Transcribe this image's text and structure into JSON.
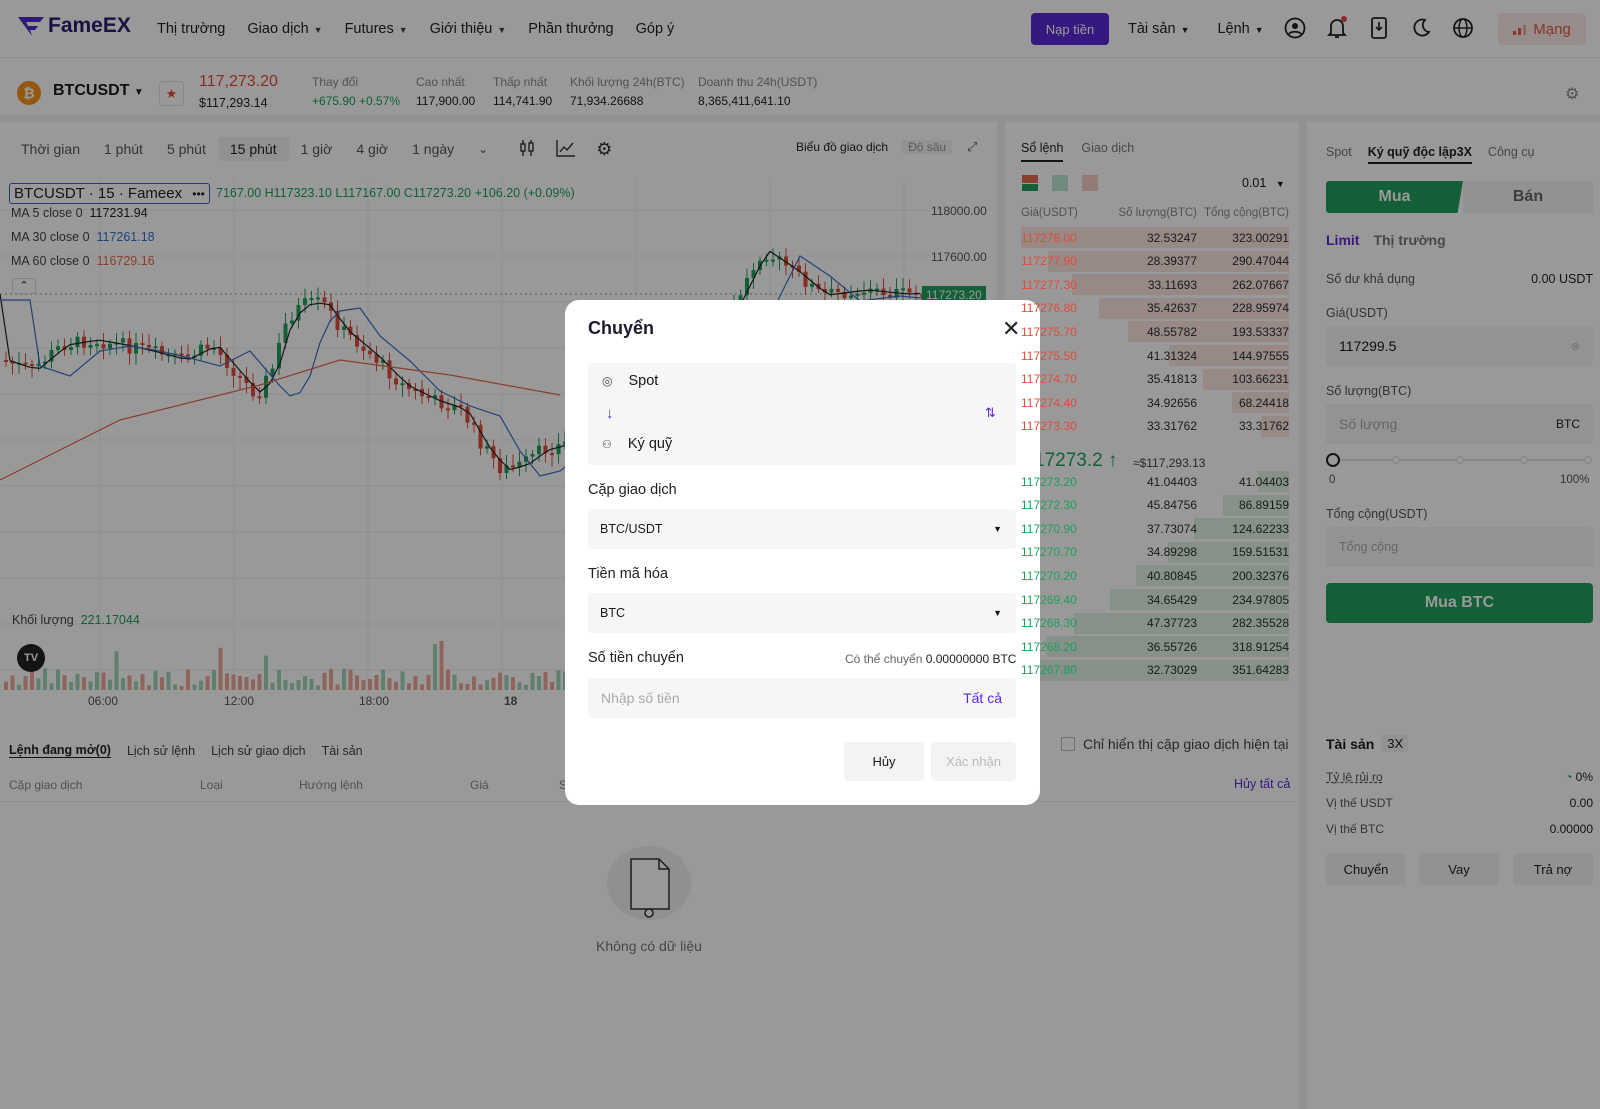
{
  "brand": {
    "name": "FameEX"
  },
  "nav": {
    "links": [
      "Thị trường",
      "Giao dịch",
      "Futures",
      "Giới thiệu",
      "Phần thưởng",
      "Góp ý"
    ],
    "deposit": "Nạp tiền",
    "assets": "Tài sản",
    "orders": "Lệnh",
    "network": "Mạng",
    "icons": [
      "user-icon",
      "bell-icon",
      "download-app-icon",
      "moon-icon",
      "globe-icon"
    ]
  },
  "ticker": {
    "pair": "BTCUSDT",
    "last": "117,273.20",
    "usd": "$117,293.14",
    "stats": [
      {
        "label": "Thay đổi",
        "value": "+675.90 +0.57%"
      },
      {
        "label": "Cao nhất",
        "value": "117,900.00"
      },
      {
        "label": "Thấp nhất",
        "value": "114,741.90"
      },
      {
        "label": "Khối lượng 24h(BTC)",
        "value": "71,934.26688"
      },
      {
        "label": "Doanh thu 24h(USDT)",
        "value": "8,365,411,641.10"
      }
    ]
  },
  "chart": {
    "timeframes": [
      "Thời gian",
      "1 phút",
      "5 phút",
      "15 phút",
      "1 giờ",
      "4 giờ",
      "1 ngày"
    ],
    "selected": "15 phút",
    "mode_trade": "Biểu đồ giao dịch",
    "mode_depth": "Độ sâu",
    "symbol_legend": "BTCUSDT · 15 · Fameex",
    "ohlc": "7167.00  H117323.10  L117167.00  C117273.20  +106.20 (+0.09%)",
    "ma": [
      {
        "label": "MA 5 close 0",
        "value": "117231.94",
        "color": "#222222"
      },
      {
        "label": "MA 30 close 0",
        "value": "117261.18",
        "color": "#3b6fc7"
      },
      {
        "label": "MA 60 close 0",
        "value": "116729.16",
        "color": "#e36a4b"
      }
    ],
    "volume_label": "Khối lượng",
    "volume_value": "221.17044",
    "y_ticks": [
      "118000.00",
      "117600.00"
    ],
    "current_price_tag": "117273.20",
    "x_ticks": [
      "06:00",
      "12:00",
      "18:00",
      "18"
    ]
  },
  "orderbook": {
    "tabs": [
      "Sổ lệnh",
      "Giao dịch"
    ],
    "precision": "0.01",
    "headers": [
      "Giá(USDT)",
      "Số lượng(BTC)",
      "Tổng cộng(BTC)"
    ],
    "asks": [
      [
        "117278.00",
        "32.53247",
        "323.00291"
      ],
      [
        "117277.90",
        "28.39377",
        "290.47044"
      ],
      [
        "117277.30",
        "33.11693",
        "262.07667"
      ],
      [
        "117276.80",
        "35.42637",
        "228.95974"
      ],
      [
        "117275.70",
        "48.55782",
        "193.53337"
      ],
      [
        "117275.50",
        "41.31324",
        "144.97555"
      ],
      [
        "117274.70",
        "35.41813",
        "103.66231"
      ],
      [
        "117274.40",
        "34.92656",
        "68.24418"
      ],
      [
        "117273.30",
        "33.31762",
        "33.31762"
      ]
    ],
    "mid": "17273.2",
    "mid_usd": "≈$117,293.13",
    "bids": [
      [
        "117273.20",
        "41.04403",
        "41.04403"
      ],
      [
        "117272.30",
        "45.84756",
        "86.89159"
      ],
      [
        "117270.90",
        "37.73074",
        "124.62233"
      ],
      [
        "117270.70",
        "34.89298",
        "159.51531"
      ],
      [
        "117270.20",
        "40.80845",
        "200.32376"
      ],
      [
        "117269.40",
        "34.65429",
        "234.97805"
      ],
      [
        "117268.30",
        "47.37723",
        "282.35528"
      ],
      [
        "117268.20",
        "36.55726",
        "318.91254"
      ],
      [
        "117267.80",
        "32.73029",
        "351.64283"
      ]
    ]
  },
  "form": {
    "tabs": [
      "Spot",
      "Ký quỹ độc lập3X",
      "Công cụ"
    ],
    "buy": "Mua",
    "sell": "Bán",
    "order_types": [
      "Limit",
      "Thị trường"
    ],
    "balance_label": "Số dư khả dụng",
    "balance_value": "0.00 USDT",
    "price_label": "Giá(USDT)",
    "price_value": "117299.5",
    "qty_label": "Số lượng(BTC)",
    "qty_placeholder": "Số lượng",
    "qty_unit": "BTC",
    "slider_min": "0",
    "slider_max": "100%",
    "total_label": "Tổng cộng(USDT)",
    "total_placeholder": "Tổng cộng",
    "submit": "Mua BTC"
  },
  "bottom": {
    "tabs": [
      "Lệnh đang mở(0)",
      "Lịch sử lệnh",
      "Lịch sử giao dịch",
      "Tài sản"
    ],
    "columns": [
      "Cặp giao dịch",
      "Loại",
      "Hướng lệnh",
      "Giá",
      "S"
    ],
    "only_current": "Chỉ hiển thị cặp giao dịch hiện tại",
    "cancel_all": "Hủy tất cả",
    "empty": "Không có dữ liệu"
  },
  "assets_panel": {
    "title": "Tài sản",
    "leverage": "3X",
    "rows": [
      {
        "label": "Tỷ lệ rủi ro",
        "value": "0%"
      },
      {
        "label": "Vị thế USDT",
        "value": "0.00"
      },
      {
        "label": "Vị thế BTC",
        "value": "0.00000"
      }
    ],
    "buttons": [
      "Chuyển",
      "Vay",
      "Trả nợ"
    ]
  },
  "modal": {
    "title": "Chuyển",
    "from": "Spot",
    "to": "Ký quỹ",
    "pair_label": "Cặp giao dịch",
    "pair_value": "BTC/USDT",
    "coin_label": "Tiền mã hóa",
    "coin_value": "BTC",
    "amount_label": "Số tiền chuyển",
    "available_prefix": "Có thể chuyển",
    "available_value": "0.00000000 BTC",
    "amount_placeholder": "Nhập số tiền",
    "all": "Tất cả",
    "cancel": "Hủy",
    "confirm": "Xác nhận"
  },
  "colors": {
    "accent": "#5b2bd6",
    "up": "#1e9e5e",
    "down": "#e24b3b"
  }
}
